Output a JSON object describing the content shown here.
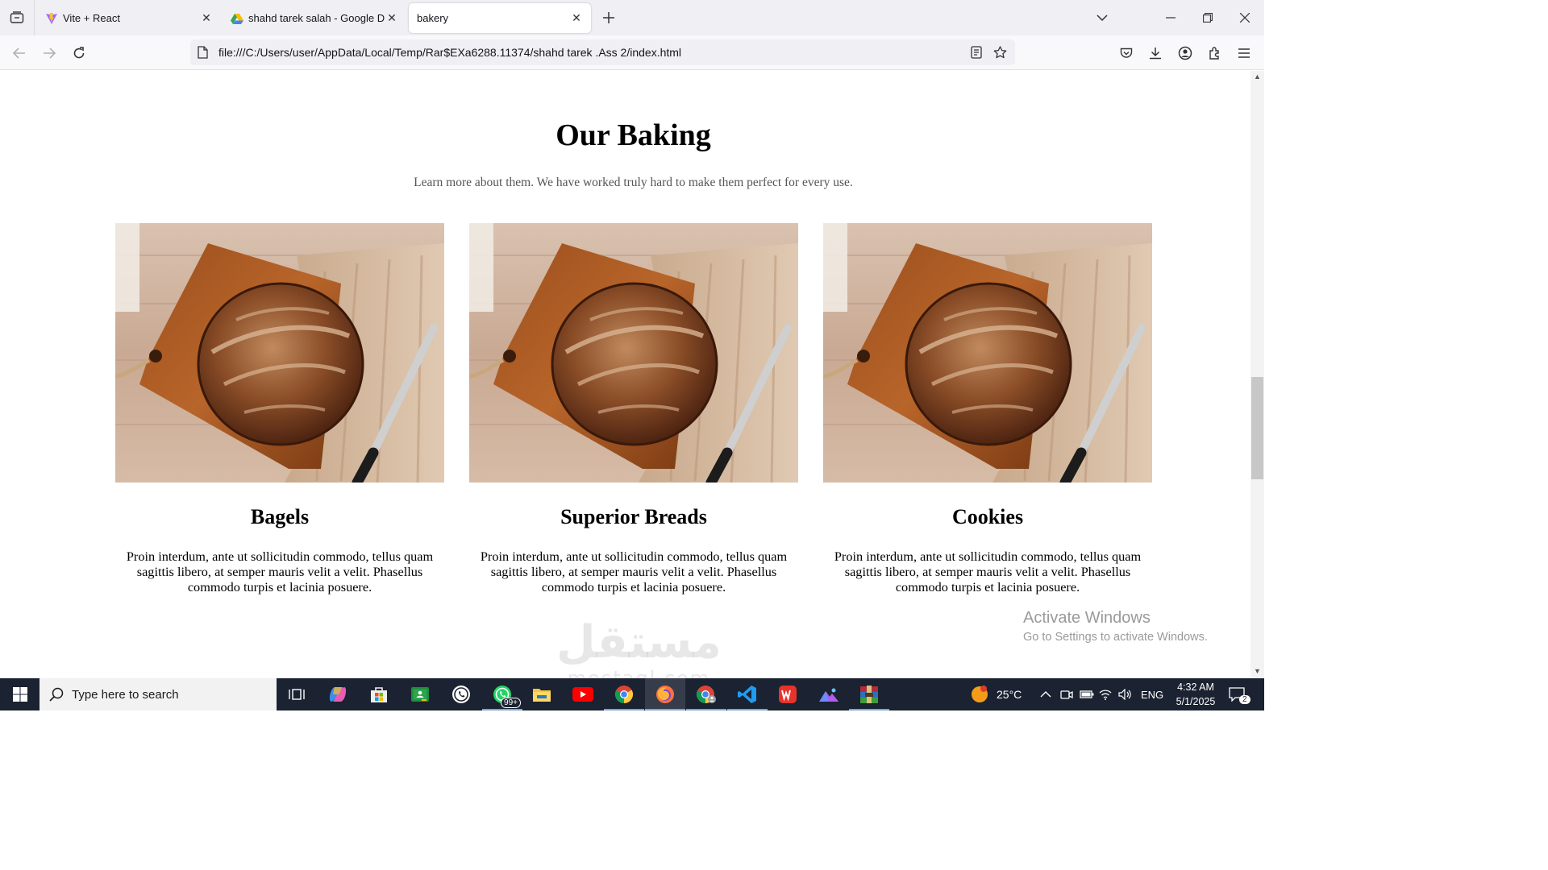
{
  "browser": {
    "tabs": [
      {
        "title": "Vite + React",
        "icon": "vite-icon",
        "active": false
      },
      {
        "title": "shahd tarek salah - Google Drive",
        "icon": "google-drive-icon",
        "active": false
      },
      {
        "title": "bakery",
        "icon": "",
        "active": true
      }
    ],
    "url": "file:///C:/Users/user/AppData/Local/Temp/Rar$EXa6288.11374/shahd tarek .Ass 2/index.html"
  },
  "page": {
    "section_title": "Our Baking",
    "section_subtitle": "Learn more about them. We have worked truly hard to make them perfect for every use.",
    "cards": [
      {
        "title": "Bagels",
        "text": "Proin interdum, ante ut sollicitudin commodo, tellus quam sagittis libero, at semper mauris velit a velit. Phasellus commodo turpis et lacinia posuere."
      },
      {
        "title": "Superior Breads",
        "text": "Proin interdum, ante ut sollicitudin commodo, tellus quam sagittis libero, at semper mauris velit a velit. Phasellus commodo turpis et lacinia posuere."
      },
      {
        "title": "Cookies",
        "text": "Proin interdum, ante ut sollicitudin commodo, tellus quam sagittis libero, at semper mauris velit a velit. Phasellus commodo turpis et lacinia posuere."
      }
    ]
  },
  "overlay": {
    "activate_title": "Activate Windows",
    "activate_sub": "Go to Settings to activate Windows.",
    "watermark_ar": "مستقل",
    "watermark_en": "mostaql.com"
  },
  "taskbar": {
    "search_placeholder": "Type here to search",
    "whatsapp_badge": "99+",
    "temperature": "25°C",
    "language": "ENG",
    "time": "4:32 AM",
    "date": "5/1/2025",
    "notification_count": "2"
  },
  "colors": {
    "tab_strip": "#f0f0f4",
    "taskbar": "#1b2231",
    "accent": "#7aa7d8"
  }
}
